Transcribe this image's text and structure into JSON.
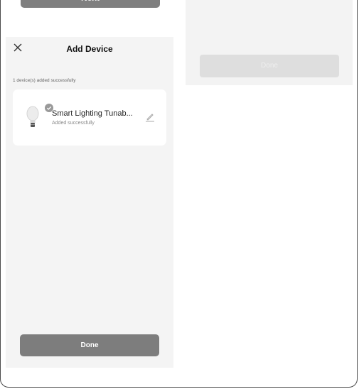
{
  "top_partial_button": {
    "label": "Next"
  },
  "right_panel": {
    "done_label": "Done"
  },
  "header": {
    "title": "Add Device"
  },
  "summary": {
    "text": "1 device(s) added successfully"
  },
  "device": {
    "name": "Smart Lighting Tunab...",
    "status": "Added successfully",
    "icon": "lightbulb-icon"
  },
  "footer": {
    "done_label": "Done"
  },
  "colors": {
    "primary_button": "#7d7d7d",
    "panel_bg": "#f4f4f4",
    "card_bg": "#ffffff"
  }
}
